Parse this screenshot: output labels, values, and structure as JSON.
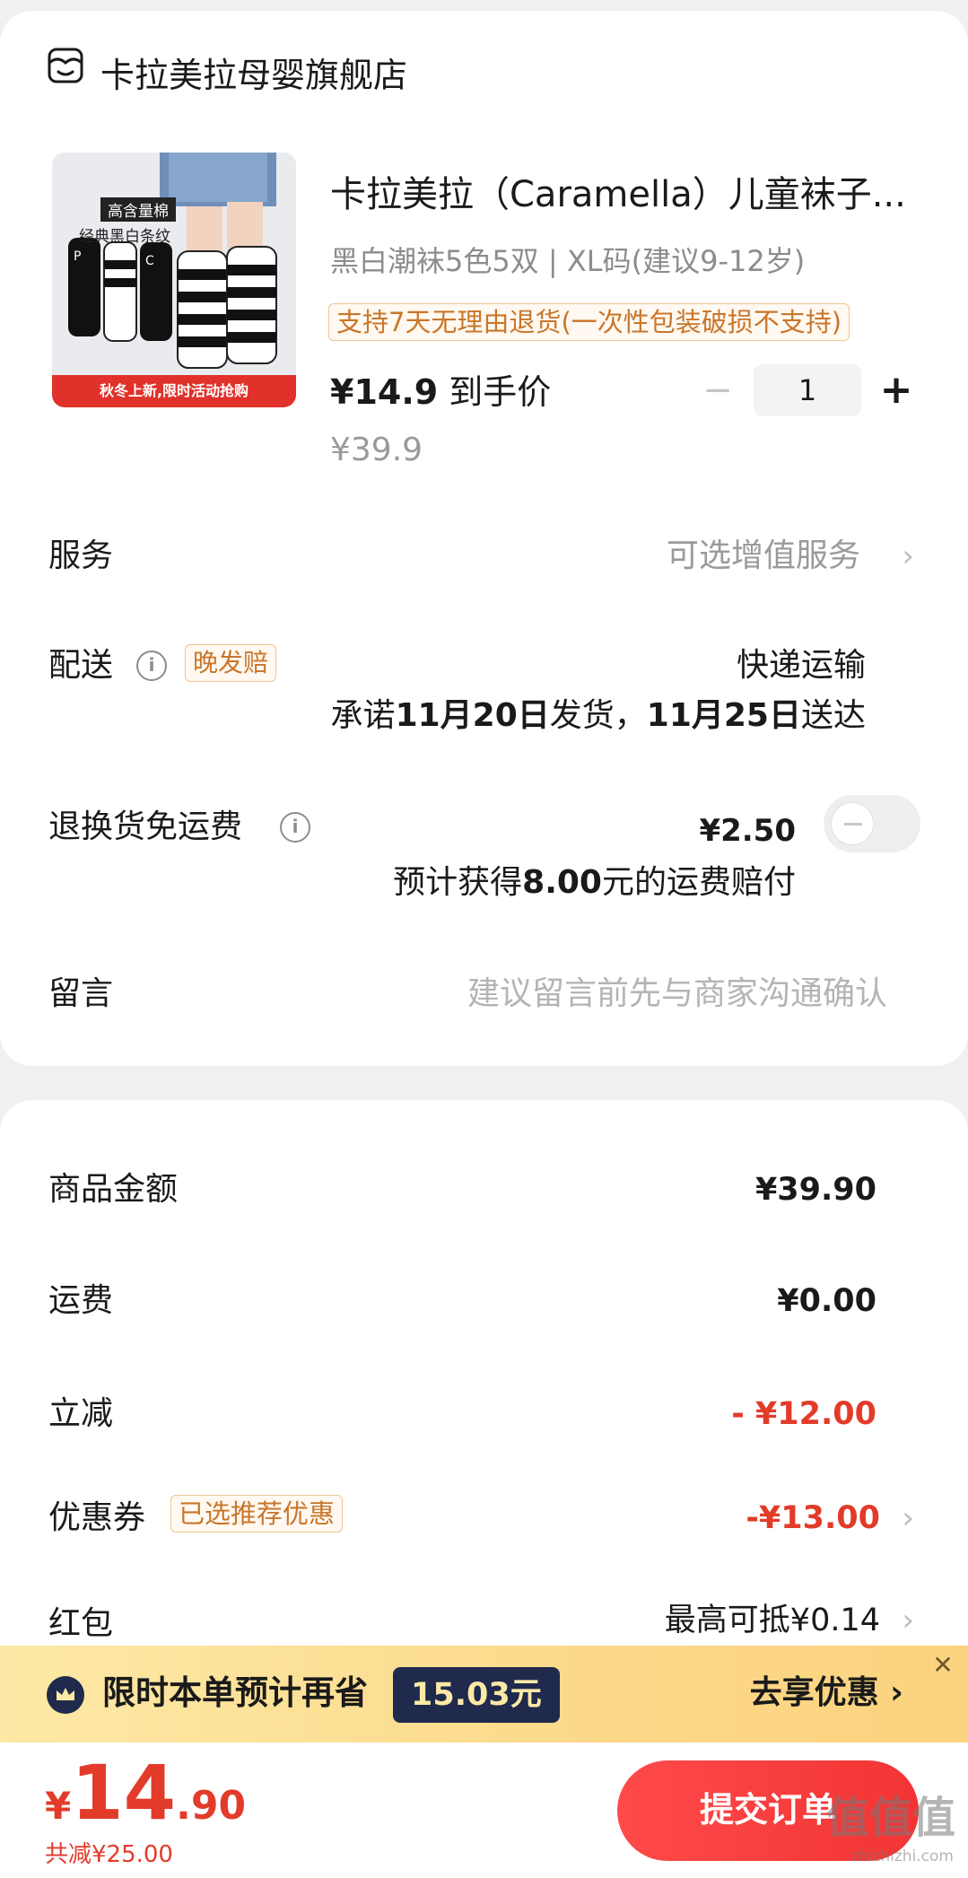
{
  "shop": {
    "name": "卡拉美拉母婴旗舰店",
    "icon": "shop-icon"
  },
  "product": {
    "title": "卡拉美拉（Caramella）儿童袜子...",
    "spec": "黑白潮袜5色5双 | XL码(建议9-12岁)",
    "return_policy": "支持7天无理由退货(一次性包装破损不支持)",
    "price": "¥14.9",
    "price_suffix": "到手价",
    "original_price": "¥39.9",
    "quantity": "1",
    "qty_minus": "−",
    "qty_plus": "+",
    "image": {
      "tag1": "高含量棉",
      "tag2": "经典黑白条纹",
      "banner": "秋冬上新,限时活动抢购"
    }
  },
  "service": {
    "label": "服务",
    "value": "可选增值服务"
  },
  "delivery": {
    "label": "配送",
    "badge": "晚发赔",
    "method": "快递运输",
    "promise_prefix": "承诺",
    "ship_date": "11月20日",
    "promise_mid": "发货，",
    "arrive_date": "11月25日",
    "promise_suffix": "送达"
  },
  "return_shipping": {
    "label": "退换货免运费",
    "price": "¥2.50",
    "comp_prefix": "预计获得",
    "comp_amount": "8.00",
    "comp_suffix": "元的运费赔付",
    "enabled": false
  },
  "message": {
    "label": "留言",
    "placeholder": "建议留言前先与商家沟通确认"
  },
  "summary": {
    "goods_label": "商品金额",
    "goods_value": "¥39.90",
    "shipping_label": "运费",
    "shipping_value": "¥0.00",
    "discount_label": "立减",
    "discount_value": "- ¥12.00",
    "coupon_label": "优惠券",
    "coupon_badge": "已选推荐优惠",
    "coupon_value": "-¥13.00",
    "redpacket_label": "红包",
    "redpacket_value": "最高可抵¥0.14"
  },
  "promo": {
    "text": "限时本单预计再省",
    "amount": "15.03元",
    "cta": "去享优惠",
    "cta_chevron": "›",
    "close": "✕"
  },
  "bottom": {
    "currency": "¥",
    "total_int": "14",
    "total_dec": ".90",
    "saved": "共减¥25.00",
    "submit": "提交订单",
    "watermark": "值值值",
    "watermark_sub": "zhizhizhi.com"
  },
  "colors": {
    "accent_red": "#e33b2a",
    "badge_orange": "#c9762a",
    "promo_navy": "#1f2a4d"
  }
}
